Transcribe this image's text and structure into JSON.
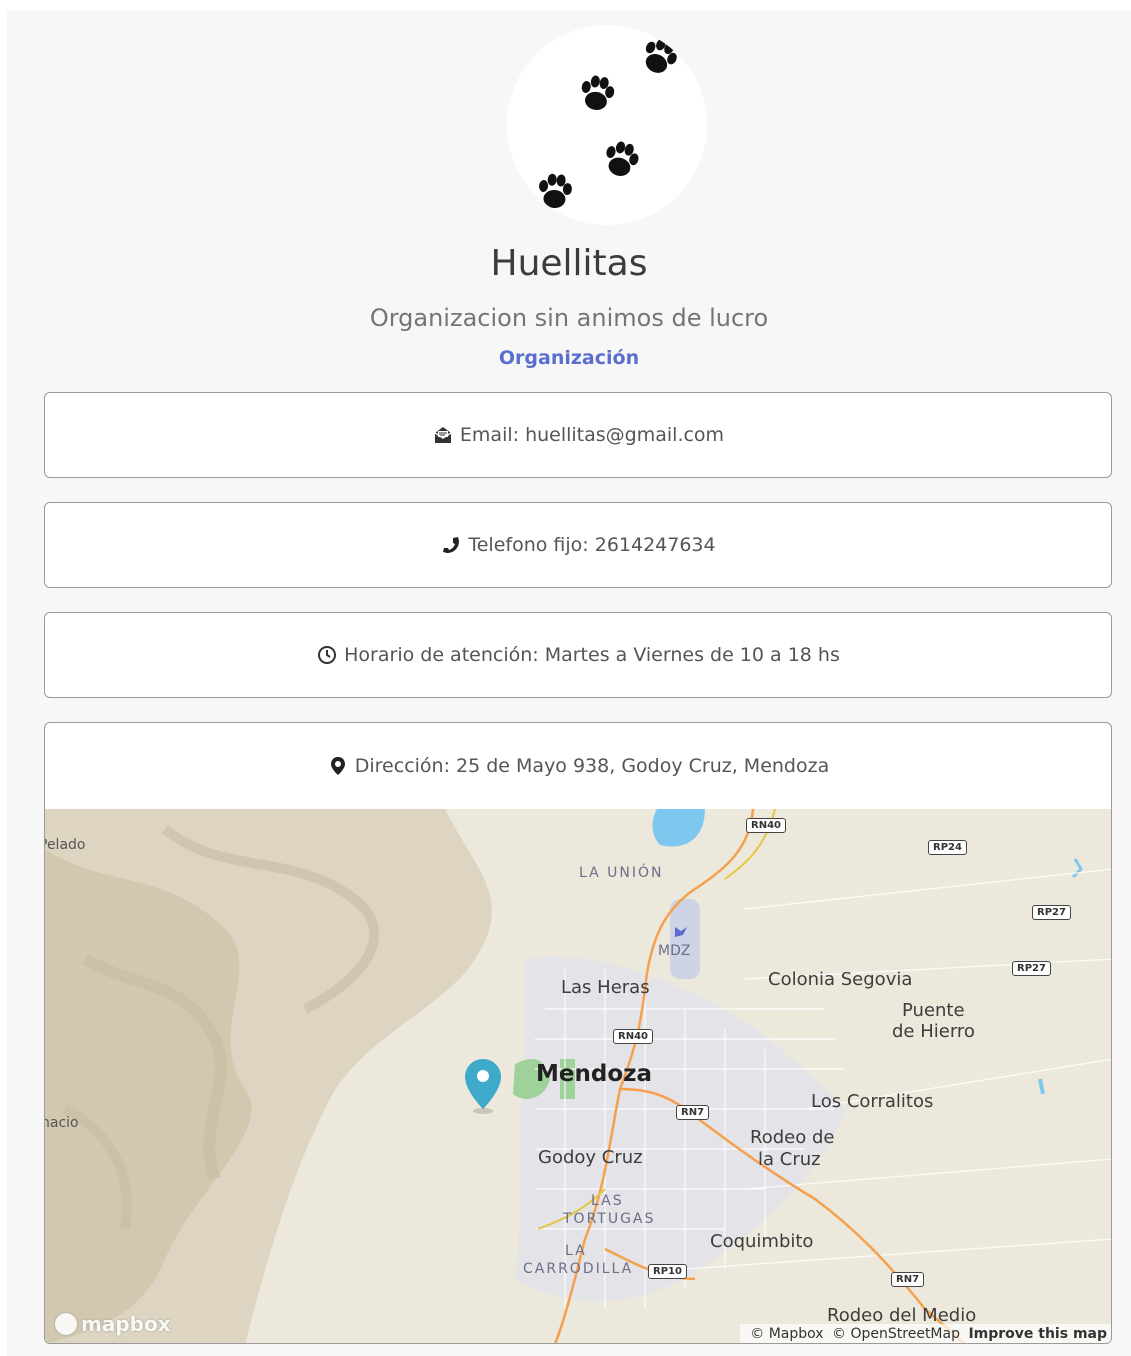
{
  "profile": {
    "name": "Huellitas",
    "description": "Organizacion sin animos de lucro",
    "type": "Organización"
  },
  "contact": {
    "email": "Email: huellitas@gmail.com",
    "phone": "Telefono fijo: 2614247634",
    "hours": "Horario de atención: Martes a Viernes de 10 a 18 hs",
    "address": "Dirección: 25 de Mayo 938, Godoy Cruz, Mendoza"
  },
  "icons": {
    "email": "envelope-open-icon",
    "phone": "phone-icon",
    "hours": "clock-icon",
    "address": "map-marker-icon"
  },
  "map": {
    "labels": {
      "la_union": "LA UNIÓN",
      "mdz": "MDZ",
      "las_heras": "Las Heras",
      "colonia_segovia": "Colonia Segovia",
      "puente": "Puente",
      "de_hierro": "de Hierro",
      "mendoza": "Mendoza",
      "los_corralitos": "Los Corralitos",
      "rodeo_de": "Rodeo de",
      "la_cruz": "la Cruz",
      "godoy_cruz": "Godoy Cruz",
      "las": "LAS",
      "tortugas": "TORTUGAS",
      "coquimbito": "Coquimbito",
      "la": "LA",
      "carrodilla": "CARRODILLA",
      "rodeo_del_medio": "Rodeo del Medio",
      "pelado": "Pelado",
      "nacio": "nacio"
    },
    "shields": {
      "rn40_top": "RN40",
      "rp24": "RP24",
      "rp27_a": "RP27",
      "rp27_b": "RP27",
      "rn40_mid": "RN40",
      "rn7_a": "RN7",
      "rp10": "RP10",
      "rn7_b": "RN7"
    },
    "logo": "mapbox",
    "attribution": {
      "mapbox": "© Mapbox",
      "osm": "© OpenStreetMap",
      "improve": "Improve this map"
    },
    "colors": {
      "land": "#ede8dc",
      "urban": "#e4e4e8",
      "park": "#9fd19a",
      "water": "#7ec8ef",
      "highway": "#f5a04d",
      "marker": "#3fa9c9"
    }
  }
}
